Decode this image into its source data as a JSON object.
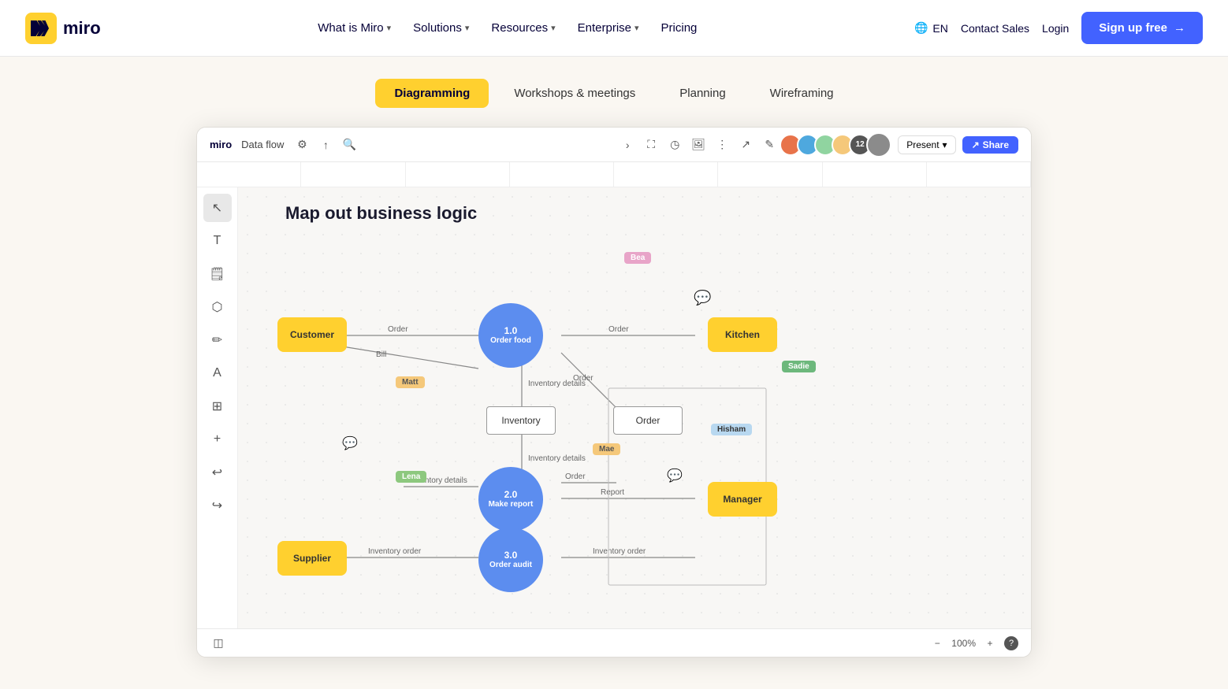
{
  "header": {
    "logo_text": "miro",
    "nav": [
      {
        "label": "What is Miro",
        "has_dropdown": true
      },
      {
        "label": "Solutions",
        "has_dropdown": true
      },
      {
        "label": "Resources",
        "has_dropdown": true
      },
      {
        "label": "Enterprise",
        "has_dropdown": true
      },
      {
        "label": "Pricing",
        "has_dropdown": false
      }
    ],
    "lang": "EN",
    "contact_sales": "Contact Sales",
    "login": "Login",
    "signup": "Sign up free"
  },
  "tabs": [
    {
      "label": "Diagramming",
      "active": true
    },
    {
      "label": "Workshops & meetings",
      "active": false
    },
    {
      "label": "Planning",
      "active": false
    },
    {
      "label": "Wireframing",
      "active": false
    }
  ],
  "canvas": {
    "toolbar": {
      "miro_label": "miro",
      "doc_title": "Data flow",
      "present_label": "Present",
      "share_label": "Share"
    },
    "diagram": {
      "title": "Map out business logic",
      "nodes": {
        "customer": "Customer",
        "kitchen": "Kitchen",
        "manager": "Manager",
        "supplier": "Supplier",
        "inventory": "Inventory",
        "order": "Order",
        "circle1": {
          "id": "1.0",
          "label": "Order food"
        },
        "circle2": {
          "id": "2.0",
          "label": "Make report"
        },
        "circle3": {
          "id": "3.0",
          "label": "Order audit"
        }
      },
      "labels": {
        "order1": "Order",
        "bill": "Bill",
        "inventory_details1": "Inventory details",
        "order2": "Order",
        "inventory_details2": "Inventory details",
        "inventory_details3": "Inventory details",
        "order3": "Order",
        "report": "Report",
        "inventory_order1": "Inventory order",
        "inventory_order2": "Inventory order"
      },
      "users": [
        {
          "name": "Bea",
          "color": "#e8a4c8"
        },
        {
          "name": "Sadie",
          "color": "#90d4a0"
        },
        {
          "name": "Matt",
          "color": "#f5c87a"
        },
        {
          "name": "Mae",
          "color": "#f5c87a"
        },
        {
          "name": "Hisham",
          "color": "#b8d8f0"
        },
        {
          "name": "Lena",
          "color": "#a8d8a0"
        }
      ]
    },
    "zoom": {
      "value": "100%",
      "minus": "−",
      "plus": "+"
    }
  }
}
